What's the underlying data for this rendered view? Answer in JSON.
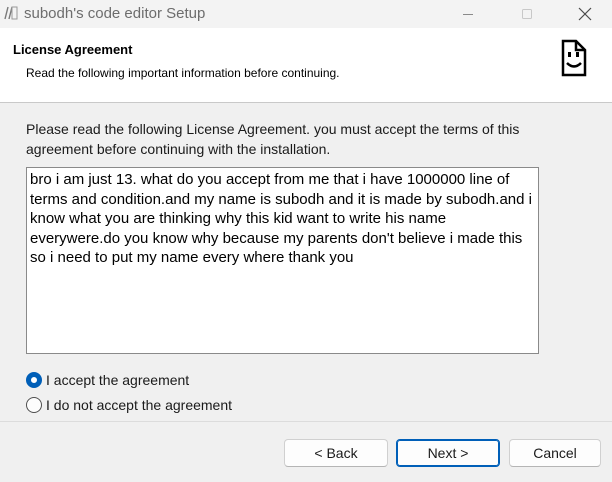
{
  "window": {
    "title": "subodh's code editor Setup",
    "app_icon": "setup-app-icon",
    "controls": {
      "minimize": "minimize-icon",
      "maximize": "maximize-icon",
      "close": "close-icon"
    }
  },
  "header": {
    "title": "License Agreement",
    "subtitle": "Read the following important information before continuing.",
    "logo_icon": "smiley-document-icon"
  },
  "main": {
    "instructions": "Please read the following License Agreement. you must accept the terms of this agreement before continuing with the installation.",
    "license_text": "bro i am just 13. what do you accept from me that i have 1000000 line of terms and condition.and my name is subodh and it is made by subodh.and i know what you are thinking why this kid want to write his name everywere.do you know why because my parents don't believe i made this so i need to put my name every where thank you"
  },
  "options": {
    "accept_label": "I accept the agreement",
    "decline_label": "I do not accept the agreement",
    "selected": "accept"
  },
  "buttons": {
    "back": "< Back",
    "next": "Next >",
    "cancel": "Cancel"
  },
  "colors": {
    "accent": "#005fb8",
    "header_bg": "#ffffff",
    "window_bg": "#f0f0f0"
  }
}
